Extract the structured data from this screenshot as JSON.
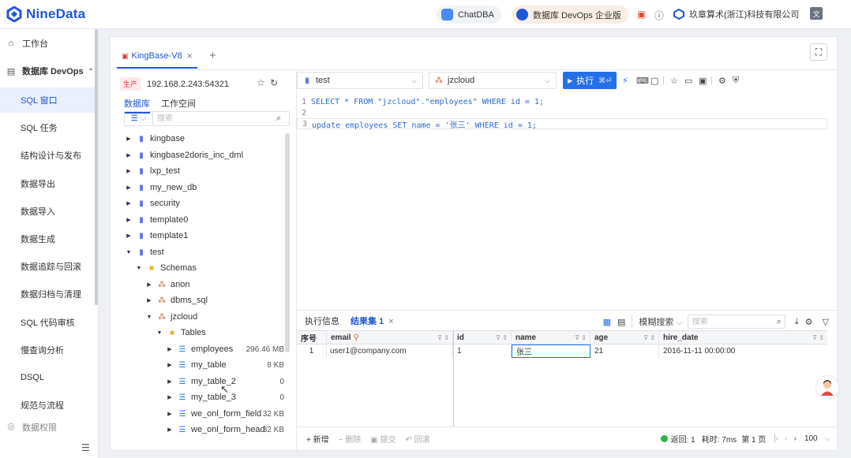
{
  "header": {
    "logo_text": "NineData",
    "chatdba_label": "ChatDBA",
    "devops_label": "数据库 DevOps 企业版",
    "org_name": "玖章算术(浙江)科技有限公司",
    "lang_icon": "translate-icon"
  },
  "sidebar": {
    "items": [
      {
        "label": "工作台",
        "icon": "home-icon"
      },
      {
        "label": "数据库 DevOps",
        "icon": "devops-icon"
      },
      {
        "label": "SQL 窗口"
      },
      {
        "label": "SQL 任务"
      },
      {
        "label": "结构设计与发布"
      },
      {
        "label": "数据导出"
      },
      {
        "label": "数据导入"
      },
      {
        "label": "数据生成"
      },
      {
        "label": "数据追踪与回滚"
      },
      {
        "label": "数据归档与清理"
      },
      {
        "label": "SQL 代码审核"
      },
      {
        "label": "慢查询分析"
      },
      {
        "label": "DSQL"
      },
      {
        "label": "规范与流程"
      },
      {
        "label": "数据权限"
      }
    ]
  },
  "file_tab": {
    "label": "KingBase-V8"
  },
  "connection": {
    "env": "生产",
    "host": "192.168.2.243:54321"
  },
  "left_tabs": [
    "数据库",
    "工作空间"
  ],
  "tree_search_placeholder": "搜索",
  "tree": [
    {
      "label": "kingbase",
      "type": "db"
    },
    {
      "label": "kingbase2doris_inc_dml",
      "type": "db"
    },
    {
      "label": "lxp_test",
      "type": "db"
    },
    {
      "label": "my_new_db",
      "type": "db"
    },
    {
      "label": "security",
      "type": "db"
    },
    {
      "label": "template0",
      "type": "db"
    },
    {
      "label": "template1",
      "type": "db"
    },
    {
      "label": "test",
      "type": "db"
    },
    {
      "label": "Schemas",
      "type": "folder"
    },
    {
      "label": "anon",
      "type": "schema"
    },
    {
      "label": "dbms_sql",
      "type": "schema"
    },
    {
      "label": "jzcloud",
      "type": "schema"
    },
    {
      "label": "Tables",
      "type": "folder"
    },
    {
      "label": "employees",
      "type": "table",
      "size": "296.46 MB"
    },
    {
      "label": "my_table",
      "type": "table",
      "size": "8 KB"
    },
    {
      "label": "my_table_2",
      "type": "table",
      "size": "0"
    },
    {
      "label": "my_table_3",
      "type": "table",
      "size": "0"
    },
    {
      "label": "we_onl_form_field",
      "type": "table",
      "size": "32 KB"
    },
    {
      "label": "we_onl_form_head",
      "type": "table",
      "size": "32 KB"
    }
  ],
  "toolbar": {
    "database": "test",
    "schema": "jzcloud",
    "run_label": "执行",
    "run_shortcut": "⌘⏎"
  },
  "editor": {
    "lines": [
      {
        "num": "1",
        "code": "SELECT * FROM \"jzcloud\".\"employees\" WHERE id = 1;"
      },
      {
        "num": "2",
        "code": ""
      },
      {
        "num": "3",
        "code": "update employees SET name = '张三' WHERE id = 1;"
      }
    ]
  },
  "results": {
    "tabs": [
      "执行信息",
      "结果集 1"
    ],
    "search_mode": "模糊搜索",
    "search_placeholder": "搜索",
    "columns": [
      "序号",
      "email",
      "id",
      "name",
      "age",
      "hire_date"
    ],
    "rows": [
      [
        "1",
        "user1@company.com",
        "1",
        "张三",
        "21",
        "2016-11-11 00:00:00"
      ]
    ],
    "footer": {
      "add": "新增",
      "delete": "删除",
      "submit": "提交",
      "rollback": "回滚",
      "returned": "返回: 1",
      "elapsed": "耗时: 7ms",
      "page": "第 1 页",
      "page_size": "100"
    }
  }
}
